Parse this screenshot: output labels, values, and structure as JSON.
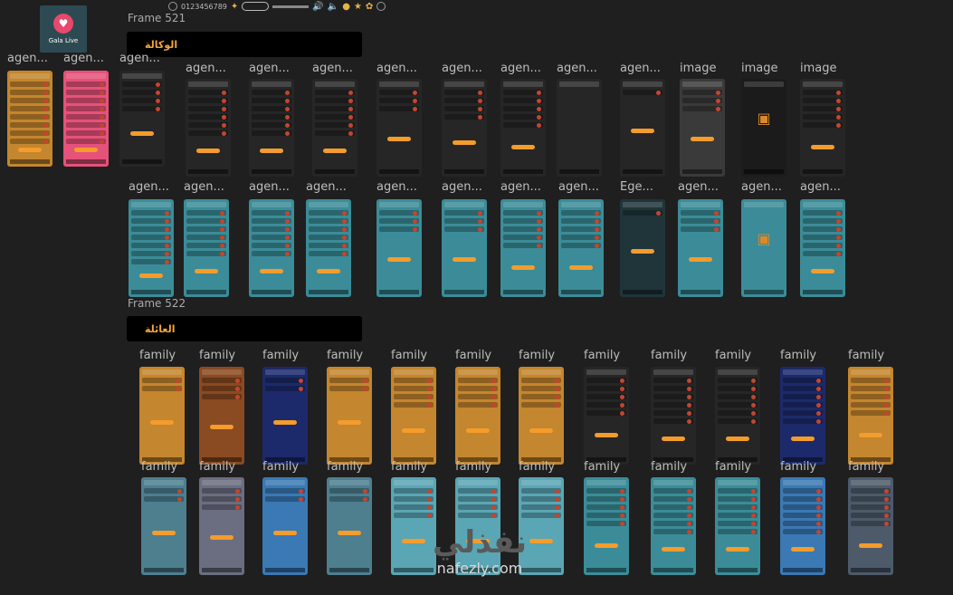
{
  "toolbar": {
    "digits": "0123456789"
  },
  "logo": {
    "text": "Gala Live"
  },
  "frames": [
    {
      "title": "Frame 521",
      "banner": "الوكالة"
    },
    {
      "title": "Frame 522",
      "banner": "العائلة"
    }
  ],
  "labels": {
    "agen": "agen...",
    "image": "image",
    "ege": "Ege...",
    "family": "family"
  },
  "watermark": {
    "arabic": "نفذلي",
    "latin": "nafezly.com"
  },
  "colors": {
    "dark": "#262626",
    "teal": "#3b8c98",
    "orange": "#c4862e",
    "pink": "#e5527a",
    "navy": "#1c2a6b"
  },
  "icons": [
    "heart-icon",
    "box-icon",
    "speaker-icon"
  ]
}
